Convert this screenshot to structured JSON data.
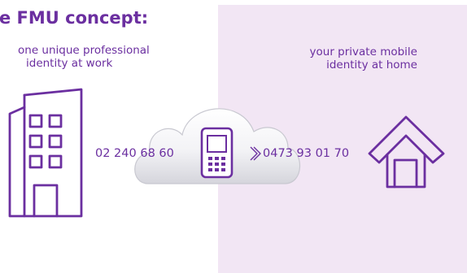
{
  "title": "e FMU concept:",
  "work": {
    "label_line1": "one unique professional",
    "label_line2": "identity at work",
    "number": "02 240 68 60"
  },
  "home": {
    "label_line1": "your private mobile",
    "label_line2": "identity at home",
    "number": "0473 93 01 70"
  },
  "icons": {
    "work": "office-building-icon",
    "phone": "mobile-phone-icon",
    "home": "house-icon",
    "cloud": "cloud-icon",
    "arrow": "chevron-right-icon"
  },
  "colors": {
    "accent": "#6b2fa0",
    "home_panel": "#f2e6f4",
    "cloud_top": "#ffffff",
    "cloud_bottom": "#d9d9df"
  }
}
